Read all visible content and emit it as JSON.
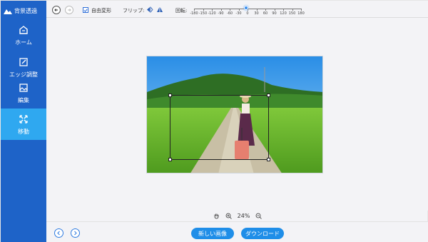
{
  "app": {
    "title": "背景透過"
  },
  "sidebar": {
    "items": [
      {
        "label": "ホーム",
        "icon": "home-icon",
        "active": false
      },
      {
        "label": "エッジ調整",
        "icon": "edit-edge-icon",
        "active": false
      },
      {
        "label": "編集",
        "icon": "image-edit-icon",
        "active": false
      },
      {
        "label": "移動",
        "icon": "move-icon",
        "active": true
      }
    ]
  },
  "toolbar": {
    "free_transform_label": "自由変形",
    "free_transform_checked": true,
    "flip_label": "フリップ:",
    "rotate_label": "回転:",
    "rotate_ticks": [
      "-180",
      "-150",
      "-120",
      "-90",
      "-60",
      "-30",
      "0",
      "30",
      "60",
      "90",
      "120",
      "150",
      "180"
    ],
    "rotate_value": 0
  },
  "zoom": {
    "value": "24%"
  },
  "actions": {
    "new_image": "新しい画像",
    "download": "ダウンロード"
  },
  "colors": {
    "sidebar": "#1e63c8",
    "active": "#2fa8f0",
    "button": "#1f8ee8"
  }
}
